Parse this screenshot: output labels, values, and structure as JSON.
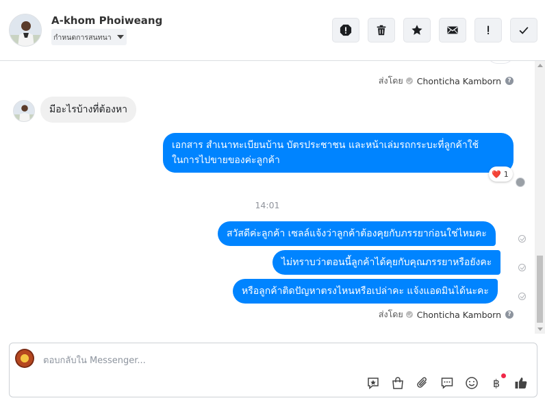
{
  "header": {
    "contact_name": "A-khom Phoiweang",
    "label_dropdown": "กำหนดการสนทนา",
    "actions": [
      {
        "name": "report-spam-button",
        "icon": "alert-octagon-icon"
      },
      {
        "name": "delete-button",
        "icon": "trash-icon"
      },
      {
        "name": "star-button",
        "icon": "star-icon"
      },
      {
        "name": "mark-unread-button",
        "icon": "envelope-icon"
      },
      {
        "name": "follow-up-button",
        "icon": "exclamation-icon"
      },
      {
        "name": "mark-done-button",
        "icon": "check-icon"
      }
    ]
  },
  "messages": {
    "sent_by_1": {
      "prefix": "ส่งโดย",
      "name": "Chonticha Kamborn",
      "help": "?"
    },
    "incoming_1": "มีอะไรบ้างที่ต้องหา",
    "outgoing_1_line1": "เอกสาร สำเนาทะเบียนบ้าน บัตรประชาชน และหน้าเล่มรถกระบะที่ลูกค้าใช้",
    "outgoing_1_line2": "ในการไปขายของค่ะลูกค้า",
    "reaction": {
      "emoji": "❤️",
      "count": "1"
    },
    "timestamp": "14:01",
    "outgoing_2": "สวัสดีค่ะลูกค้า เซลล์แจ้งว่าลูกค้าต้องคุยกับภรรยาก่อนใช่ไหมคะ",
    "outgoing_3": "ไม่ทราบว่าตอนนี้ลูกค้าได้คุยกับคุณภรรยาหรือยังคะ",
    "outgoing_4": "หรือลูกค้าติดปัญหาตรงไหนหรือเปล่าคะ แจ้งแอดมินได้นะคะ",
    "sent_by_2": {
      "prefix": "ส่งโดย",
      "name": "Chonticha Kamborn",
      "help": "?"
    }
  },
  "composer": {
    "placeholder": "ตอบกลับใน Messenger...",
    "tools": [
      "saved-reply-icon",
      "shopping-bag-icon",
      "paperclip-icon",
      "chat-bubble-icon",
      "emoji-icon",
      "baht-payment-icon",
      "thumbs-up-icon"
    ]
  },
  "colors": {
    "outgoing_bubble": "#0084ff",
    "incoming_bubble": "#f0f0f0",
    "notify_dot": "#f02849"
  }
}
